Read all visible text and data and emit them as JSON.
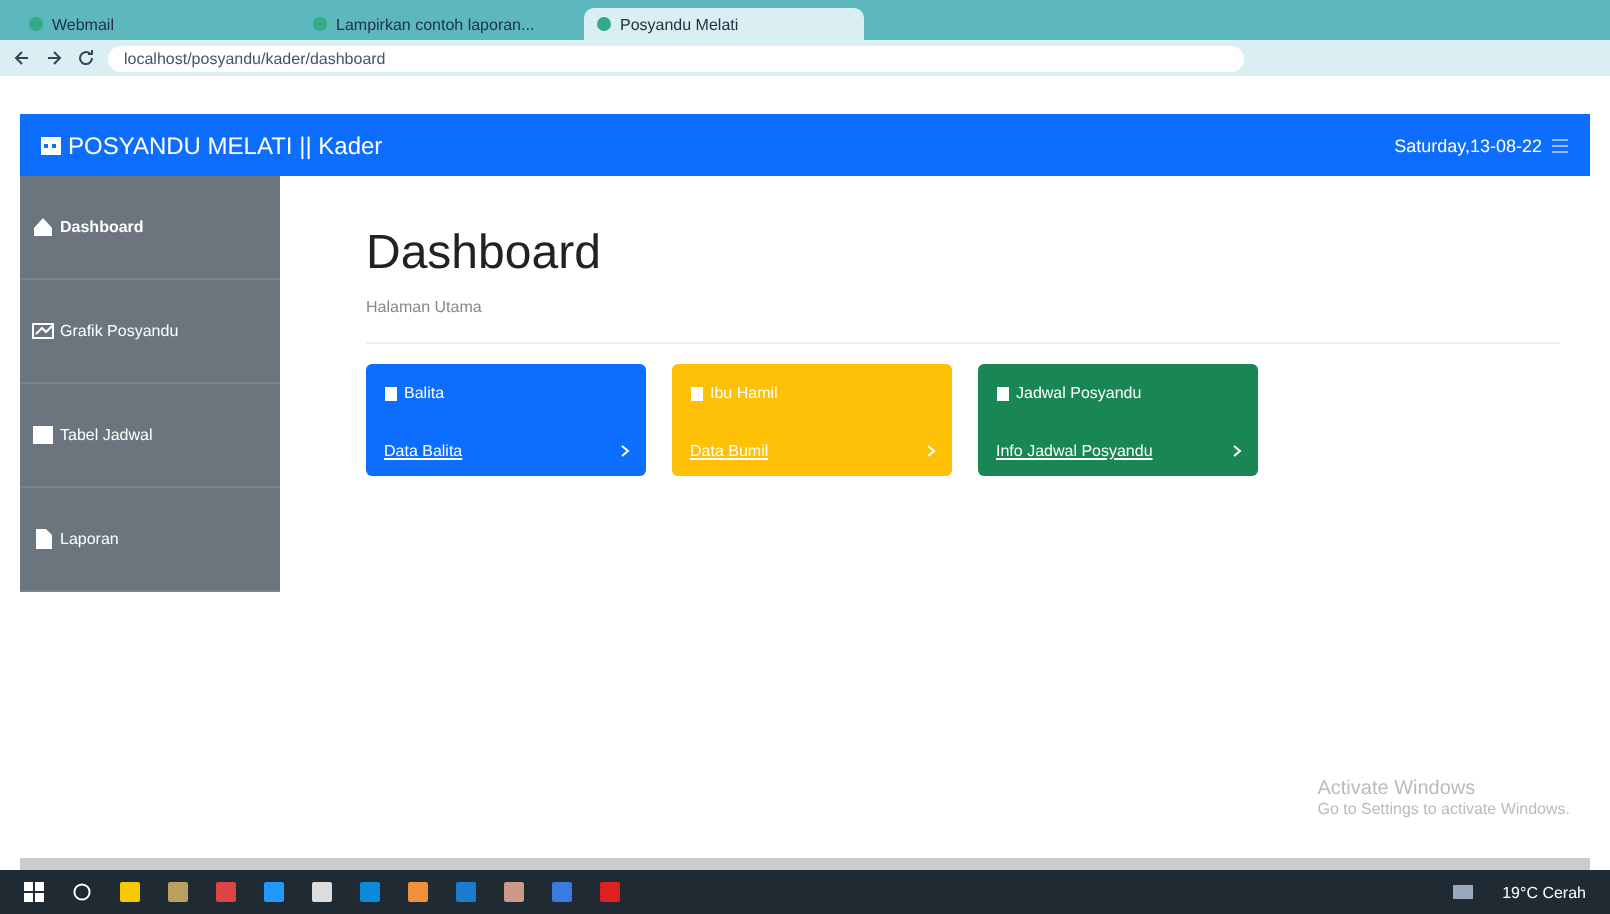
{
  "browser": {
    "tabs": [
      {
        "label": "Webmail",
        "selected": false
      },
      {
        "label": "Lampirkan contoh laporan...",
        "selected": false
      },
      {
        "label": "Posyandu Melati",
        "selected": true
      }
    ],
    "address": "localhost/posyandu/kader/dashboard"
  },
  "navbar": {
    "brand": "POSYANDU MELATI || Kader",
    "date": "Saturday,13-08-22"
  },
  "sidebar": {
    "items": [
      {
        "label": "Dashboard",
        "selected": true
      },
      {
        "label": "Grafik Posyandu",
        "selected": false
      },
      {
        "label": "Tabel Jadwal",
        "selected": false
      },
      {
        "label": "Laporan",
        "selected": false
      }
    ]
  },
  "page": {
    "title": "Dashboard",
    "subtitle": "Halaman Utama"
  },
  "cards": [
    {
      "title": "Balita",
      "link": "Data Balita",
      "color": "#0d6efd"
    },
    {
      "title": "Ibu Hamil",
      "link": "Data Bumil",
      "color": "#ffc107"
    },
    {
      "title": "Jadwal Posyandu",
      "link": "Info Jadwal Posyandu",
      "color": "#198754"
    }
  ],
  "activation": {
    "title": "Activate Windows",
    "text": "Go to Settings to activate Windows."
  },
  "taskbar": {
    "weather": "19°C Cerah"
  }
}
